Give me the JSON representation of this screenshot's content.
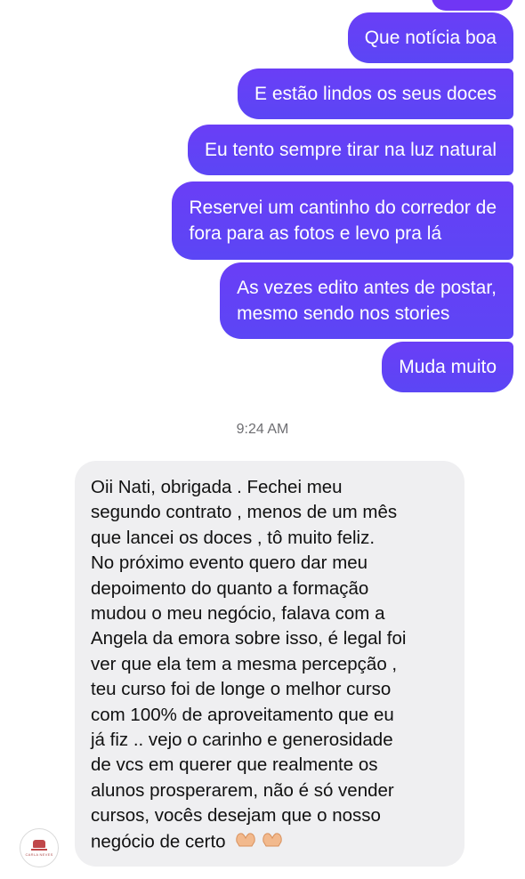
{
  "colors": {
    "outgoing_bubble": "#5b46f5",
    "incoming_bubble": "#efeff1",
    "timestamp_text": "#6e6e72"
  },
  "outgoing_messages": [
    "Que notícia boa",
    "E estão lindos os seus doces",
    "Eu tento sempre tirar na luz natural",
    "Reservei um cantinho do corredor de fora para as fotos e levo pra lá",
    "As vezes edito antes de postar, mesmo sendo nos stories",
    "Muda muito"
  ],
  "outgoing_message_lines": {
    "m4": [
      "Reservei um cantinho do corredor de",
      "fora para as fotos e levo pra lá"
    ],
    "m5": [
      "As vezes edito antes de postar,",
      "mesmo sendo nos stories"
    ]
  },
  "timestamp": "9:24 AM",
  "incoming_message": {
    "lines": [
      "Oii Nati, obrigada . Fechei meu",
      "segundo contrato , menos de um mês",
      "que lancei os doces , tô muito feliz.",
      "No próximo evento  quero dar meu",
      "depoimento do quanto a formação",
      "mudou o meu negócio, falava com a",
      "Angela da emora sobre isso, é legal foi",
      "ver que ela tem a mesma percepção ,",
      "teu curso foi de longe o melhor curso",
      "com 100% de aproveitamento que eu",
      "já fiz .. vejo o carinho e generosidade",
      "de vcs em querer que realmente os",
      "alunos prosperarem, não é só vender",
      "cursos, vocês desejam que o nosso",
      "negócio de certo"
    ],
    "emoji": "heart-hands-emoji x2"
  },
  "avatar": {
    "icon": "cake-logo-icon",
    "brand_text": "CARLA NEVES"
  }
}
